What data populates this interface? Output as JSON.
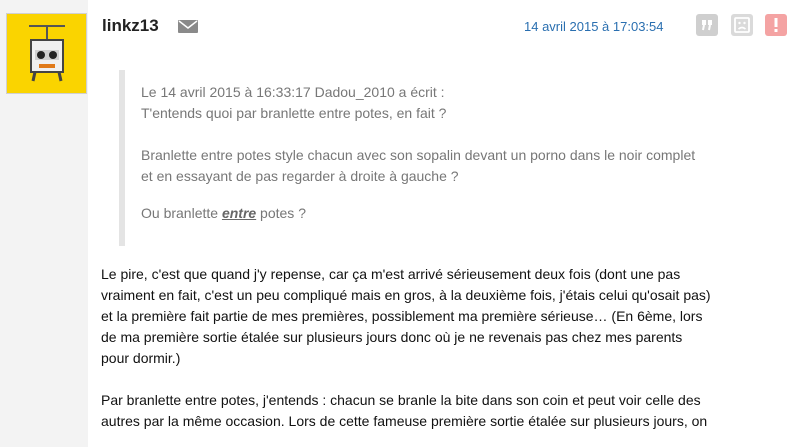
{
  "post": {
    "username": "linkz13",
    "timestamp": "14 avril 2015 à 17:03:54",
    "icons": {
      "avatar": "robot-avatar",
      "message": "mail-icon",
      "quote": "quote-icon",
      "downvote": "sad-face-icon",
      "report": "alert-icon"
    },
    "quote": {
      "header": "Le 14 avril 2015 à 16:33:17 Dadou_2010 a écrit :",
      "line1": "T'entends quoi par branlette entre potes, en fait ?",
      "para2_line1": "Branlette entre potes style chacun avec son sopalin devant un porno dans le noir complet",
      "para2_line2": "et en essayant de pas regarder à droite à gauche ?",
      "para3_before": "Ou branlette ",
      "para3_emphasis": "entre",
      "para3_after": " potes ?"
    },
    "body": {
      "p1": [
        "Le pire, c'est que quand j'y repense, car ça m'est arrivé sérieusement deux fois (dont une pas",
        "vraiment en fait, c'est un peu compliqué mais en gros, à la deuxième fois, j'étais celui qu'osait pas)",
        "et la première fait partie de mes premières, possiblement ma première sérieuse… (En 6ème, lors",
        "de ma première sortie étalée sur plusieurs jours donc où je ne revenais pas chez mes parents",
        "pour dormir.)"
      ],
      "p2": [
        "Par branlette entre potes, j'entends : chacun se branle la bite dans son coin et peut voir celle des",
        "autres par la même occasion. Lors de cette fameuse première sortie étalée sur plusieurs jours, on"
      ]
    }
  }
}
